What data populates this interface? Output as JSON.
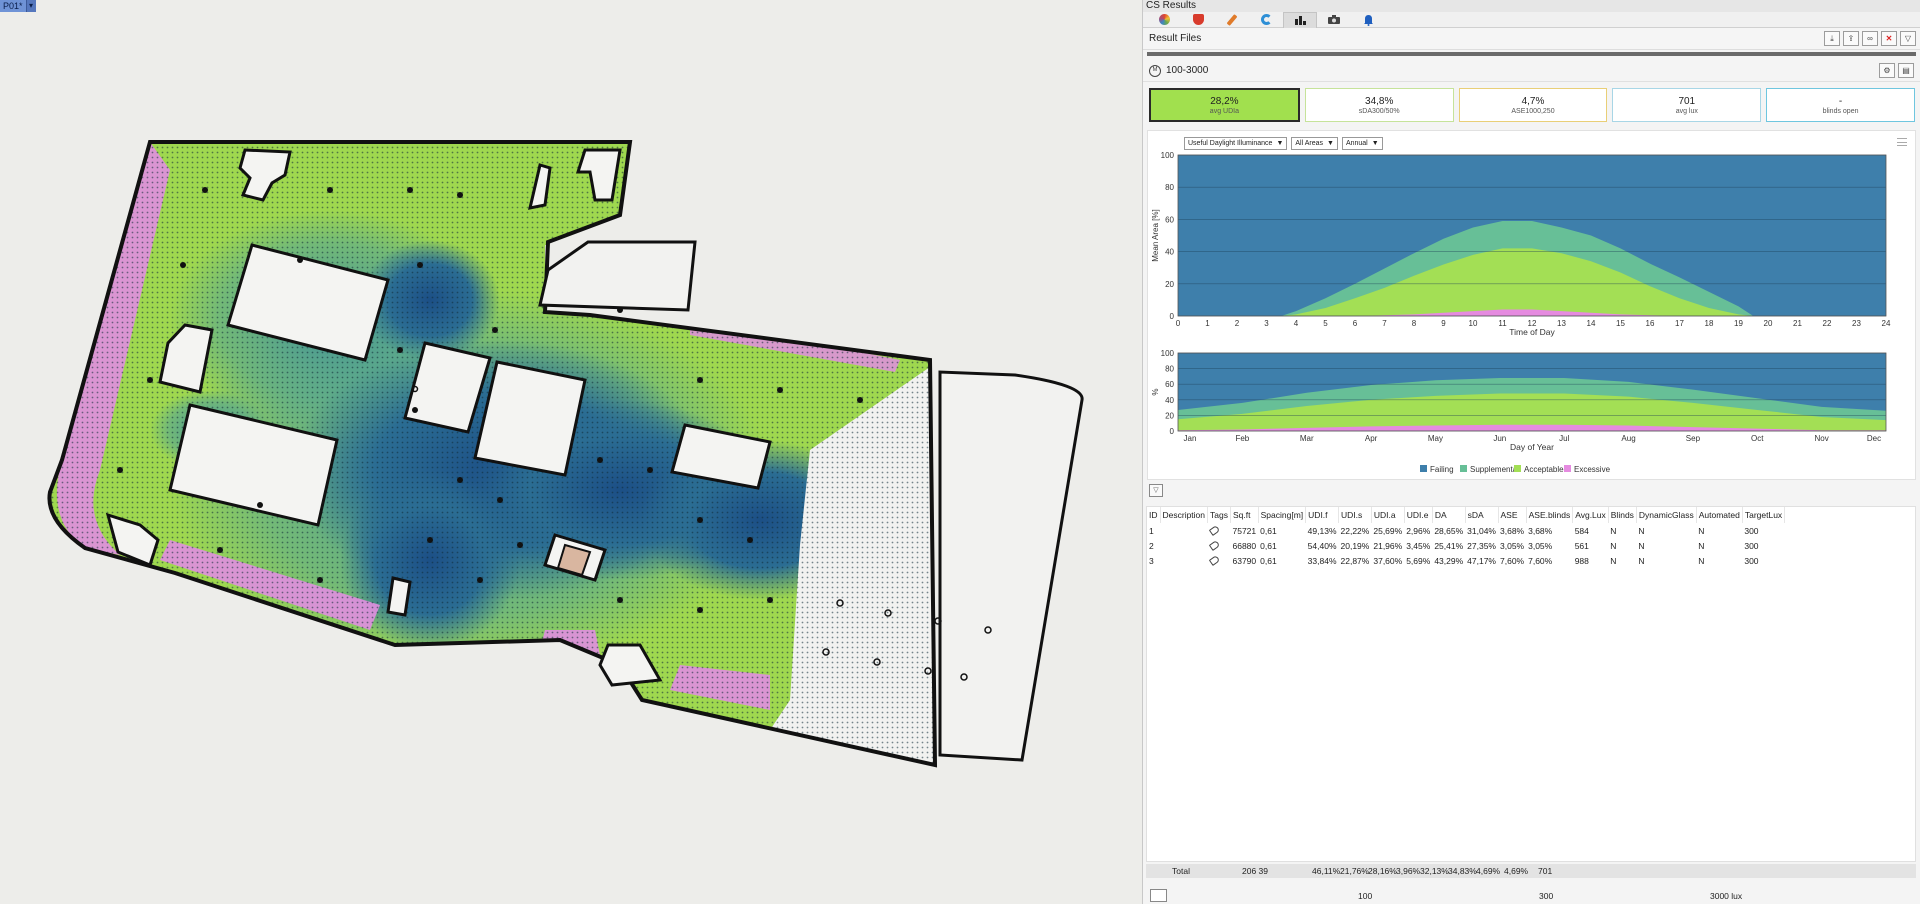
{
  "viewport": {
    "tab_label": "P01*",
    "tab_arrow": "▾"
  },
  "panel": {
    "title": "CS Results",
    "tabs": [
      {
        "icon": "color-wheel-icon",
        "color": "#e0452f"
      },
      {
        "icon": "shield-icon",
        "color": "#d83b2c"
      },
      {
        "icon": "pencil-icon",
        "color": "#e07b2a"
      },
      {
        "icon": "g-logo-icon",
        "color": "#2e8fd6"
      },
      {
        "icon": "bar-chart-icon",
        "color": "#222222"
      },
      {
        "icon": "camera-icon",
        "color": "#444444"
      },
      {
        "icon": "bell-icon",
        "color": "#1f5fbf"
      }
    ],
    "result_files_label": "Result Files",
    "file_name": "100-3000",
    "metrics": [
      {
        "value": "28,2%",
        "label": "avg UDIa"
      },
      {
        "value": "34,8%",
        "label": "sDA300/50%"
      },
      {
        "value": "4,7%",
        "label": "ASE1000,250"
      },
      {
        "value": "701",
        "label": "avg lux"
      },
      {
        "value": "-",
        "label": "blinds open"
      }
    ],
    "selectors": {
      "metric": "Useful Daylight Illuminance",
      "area": "All Areas",
      "period": "Annual"
    }
  },
  "chart_data": [
    {
      "type": "area",
      "xlabel": "Time of Day",
      "ylabel": "Mean Area [%]",
      "xlim": [
        0,
        24
      ],
      "ylim": [
        0,
        100
      ],
      "x_ticks": [
        0,
        1,
        2,
        3,
        4,
        5,
        6,
        7,
        8,
        9,
        10,
        11,
        12,
        13,
        14,
        15,
        16,
        17,
        18,
        19,
        20,
        21,
        22,
        23,
        24
      ],
      "y_ticks": [
        0,
        20,
        40,
        60,
        80,
        100
      ],
      "x": [
        0,
        3.5,
        4,
        5,
        6,
        7,
        8,
        9,
        10,
        11,
        11.5,
        12,
        13,
        14,
        15,
        16,
        17,
        18,
        19,
        19.5,
        23.5
      ],
      "series": [
        {
          "name": "Excessive",
          "color": "#e58be0",
          "values": [
            0,
            0,
            0,
            0,
            0,
            0.5,
            1,
            2,
            3,
            4,
            4,
            4,
            3,
            2,
            1,
            0.5,
            0,
            0,
            0,
            0,
            0
          ]
        },
        {
          "name": "Acceptable",
          "color": "#a3df55",
          "values": [
            0,
            0,
            1,
            5,
            11,
            17,
            24,
            30,
            35,
            38,
            38,
            38,
            36,
            32,
            26,
            18,
            11,
            5,
            1,
            0,
            0
          ]
        },
        {
          "name": "Supplemental",
          "color": "#67bf97",
          "values": [
            0,
            0,
            2,
            6,
            9,
            12,
            14,
            16,
            17,
            17,
            17,
            17,
            16,
            16,
            15,
            14,
            13,
            10,
            5,
            0,
            0
          ]
        },
        {
          "name": "Failing",
          "color": "#3e7fab",
          "values": [
            100,
            100,
            97,
            89,
            80,
            70.5,
            61,
            52,
            45,
            41,
            41,
            41,
            45,
            50,
            58,
            67.5,
            76,
            85,
            94,
            100,
            100
          ]
        }
      ]
    },
    {
      "type": "area",
      "xlabel": "Day of Year",
      "ylabel": "%",
      "ylim": [
        0,
        100
      ],
      "y_ticks": [
        0,
        20,
        40,
        60,
        80,
        100
      ],
      "categories": [
        "Jan",
        "Feb",
        "Mar",
        "Apr",
        "May",
        "Jun",
        "Jul",
        "Aug",
        "Sep",
        "Oct",
        "Nov",
        "Dec"
      ],
      "series": [
        {
          "name": "Excessive",
          "color": "#e58be0",
          "values": [
            1,
            2,
            4,
            6,
            7,
            8,
            8,
            7,
            5,
            3,
            1,
            1
          ]
        },
        {
          "name": "Acceptable",
          "color": "#a3df55",
          "values": [
            14,
            20,
            28,
            34,
            38,
            40,
            40,
            37,
            31,
            24,
            17,
            13
          ]
        },
        {
          "name": "Supplemental",
          "color": "#67bf97",
          "values": [
            12,
            14,
            17,
            19,
            20,
            20,
            20,
            19,
            17,
            15,
            13,
            12
          ]
        },
        {
          "name": "Failing",
          "color": "#3e7fab",
          "values": [
            73,
            64,
            51,
            41,
            35,
            32,
            32,
            37,
            47,
            58,
            69,
            74
          ]
        }
      ]
    }
  ],
  "legend": [
    {
      "name": "Failing",
      "color": "#3e7fab"
    },
    {
      "name": "Supplemental",
      "color": "#67bf97"
    },
    {
      "name": "Acceptable",
      "color": "#a3df55"
    },
    {
      "name": "Excessive",
      "color": "#e58be0"
    }
  ],
  "table": {
    "headers": [
      "ID",
      "Description",
      "Tags",
      "Sq.ft",
      "Spacing[m]",
      "UDI.f",
      "UDI.s",
      "UDI.a",
      "UDI.e",
      "DA",
      "sDA",
      "ASE",
      "ASE.blinds",
      "Avg.Lux",
      "Blinds",
      "DynamicGlass",
      "Automated",
      "TargetLux"
    ],
    "rows": [
      [
        "1",
        "",
        "",
        "75721",
        "0,61",
        "49,13%",
        "22,22%",
        "25,69%",
        "2,96%",
        "28,65%",
        "31,04%",
        "3,68%",
        "3,68%",
        "584",
        "N",
        "N",
        "N",
        "300"
      ],
      [
        "2",
        "",
        "",
        "66880",
        "0,61",
        "54,40%",
        "20,19%",
        "21,96%",
        "3,45%",
        "25,41%",
        "27,35%",
        "3,05%",
        "3,05%",
        "561",
        "N",
        "N",
        "N",
        "300"
      ],
      [
        "3",
        "",
        "",
        "63790",
        "0,61",
        "33,84%",
        "22,87%",
        "37,60%",
        "5,69%",
        "43,29%",
        "47,17%",
        "7,60%",
        "7,60%",
        "988",
        "N",
        "N",
        "N",
        "300"
      ]
    ],
    "total": {
      "label": "Total",
      "sqft": "206 39",
      "udif": "46,11%",
      "udis": "21,76%",
      "udia": "28,16%",
      "udie": "3,96%",
      "da": "32,13%",
      "sda": "34,83%",
      "ase": "4,69%",
      "aseb": "4,69%",
      "avglux": "701"
    },
    "scale": {
      "low": "100",
      "mid": "300",
      "high": "3000 lux"
    }
  }
}
